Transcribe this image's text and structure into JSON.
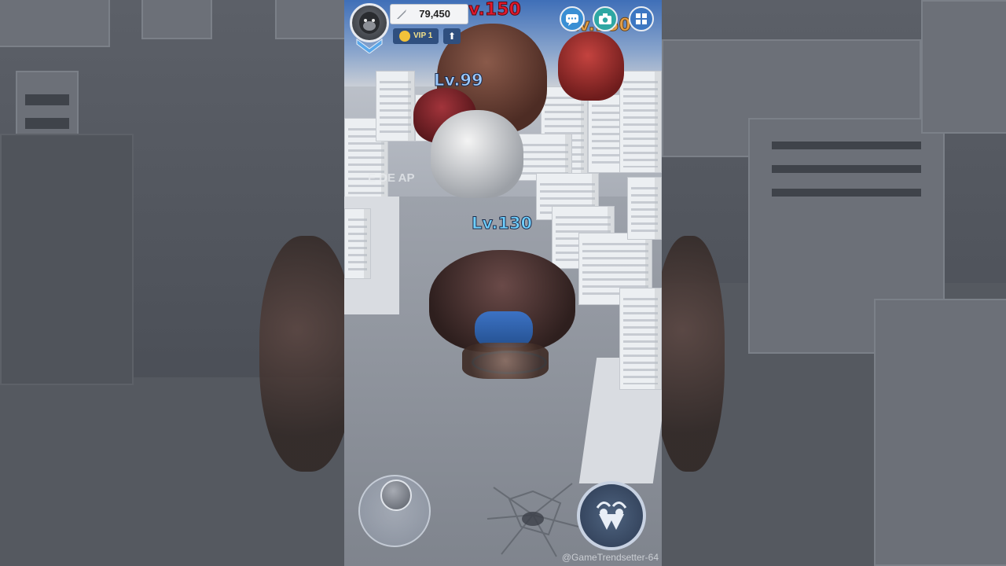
{
  "hud": {
    "score": "79,450",
    "vip_label": "VIP 1",
    "upgrade_glyph": "⬆"
  },
  "enemy_levels": {
    "top_center": "v.150",
    "top_right": "Lv.150",
    "mid": "Lv.99"
  },
  "player": {
    "level": "Lv.130"
  },
  "faded_text": "E DE AP",
  "watermark": "@GameTrendsetter-64",
  "buttons": {
    "chat": "chat-icon",
    "camera": "camera-icon",
    "menu": "grid-menu-icon",
    "attack": "claws-attack-icon"
  },
  "colors": {
    "level_red": "#e0192c",
    "level_blue": "#6fd0ff",
    "level_orange": "#f2a23a",
    "vip_gold": "#f4e28a"
  }
}
